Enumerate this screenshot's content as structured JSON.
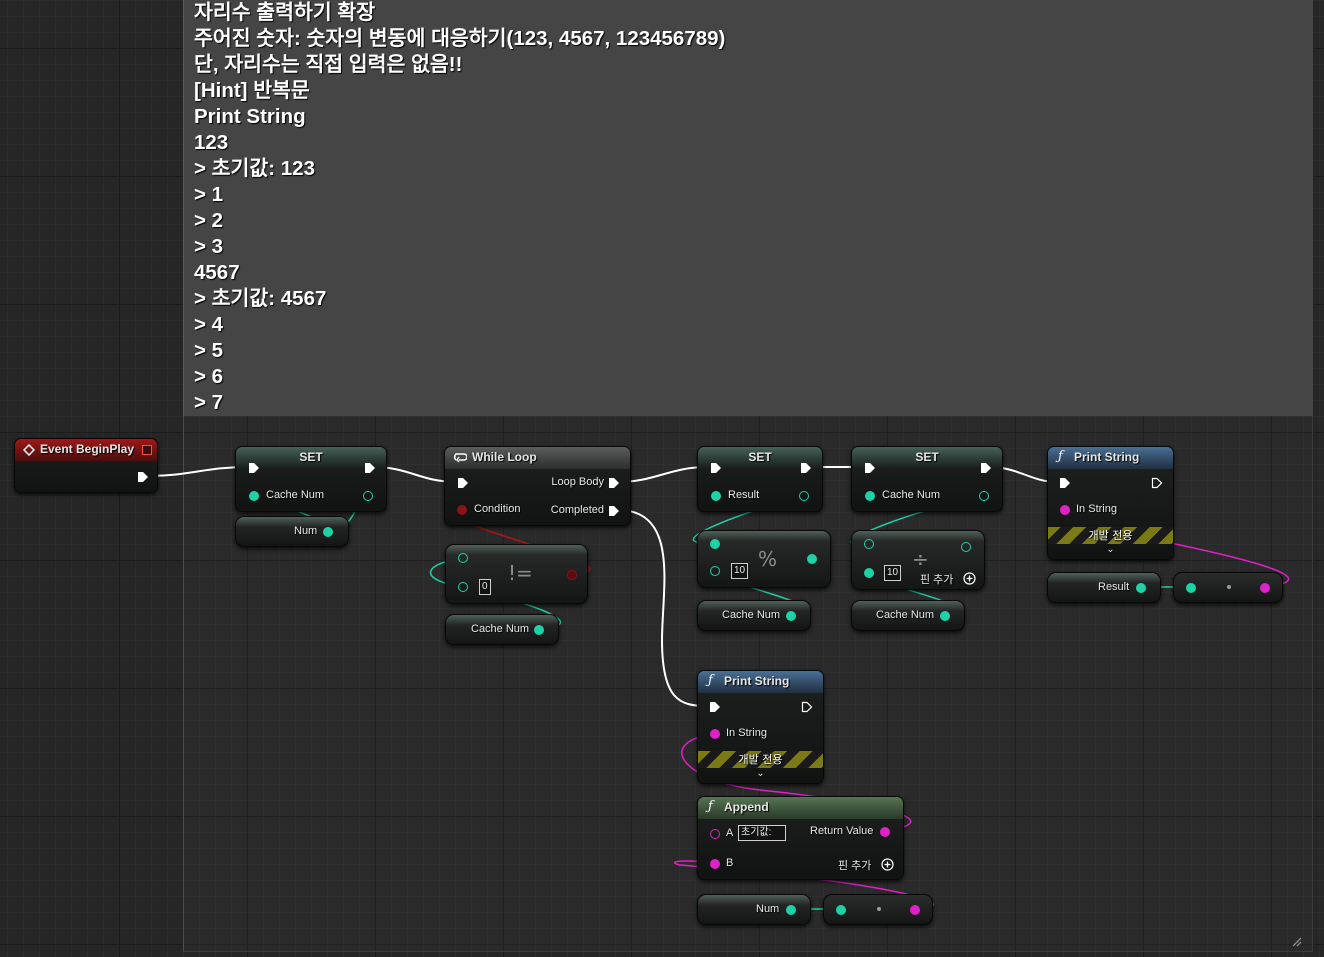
{
  "comment": {
    "lines": [
      "자리수 출력하기 확장",
      "주어진 숫자: 숫자의 변동에 대응하기(123, 4567, 123456789)",
      "단, 자리수는 직접 입력은 없음!!",
      "[Hint] 반복문",
      "Print String",
      "123",
      "> 초기값: 123",
      "> 1",
      "> 2",
      "> 3",
      "4567",
      "> 초기값: 4567",
      "> 4",
      "> 5",
      "> 6",
      "> 7"
    ]
  },
  "nodes": {
    "event": {
      "title": "Event BeginPlay"
    },
    "set1": {
      "title": "SET",
      "pin": "Cache Num"
    },
    "num1": {
      "label": "Num"
    },
    "while": {
      "title": "While Loop",
      "loop_body": "Loop Body",
      "condition": "Condition",
      "completed": "Completed"
    },
    "neq": {
      "op": "!=",
      "value": "0"
    },
    "cache1": {
      "label": "Cache Num"
    },
    "set2": {
      "title": "SET",
      "pin": "Result"
    },
    "mod": {
      "op": "%",
      "value": "10"
    },
    "cache2": {
      "label": "Cache Num"
    },
    "set3": {
      "title": "SET",
      "pin": "Cache Num"
    },
    "div": {
      "op": "÷",
      "value": "10",
      "add_pin": "핀 추가"
    },
    "cache3": {
      "label": "Cache Num"
    },
    "print1": {
      "title": "Print String",
      "in_string": "In String",
      "dev_only": "개발 전용"
    },
    "result": {
      "label": "Result"
    },
    "print2": {
      "title": "Print String",
      "in_string": "In String",
      "dev_only": "개발 전용"
    },
    "append": {
      "title": "Append",
      "a": "A",
      "a_value": "초기값:",
      "b": "B",
      "return_value": "Return Value",
      "add_pin": "핀 추가"
    },
    "num2": {
      "label": "Num"
    }
  },
  "colors": {
    "int": "#1ed2a8",
    "string": "#e020c8",
    "bool": "#8e1313",
    "exec": "#ffffff"
  },
  "icons": [
    "event-icon",
    "loop-icon",
    "function-icon",
    "add-pin-icon",
    "chevron-down-icon",
    "resize-grip-icon"
  ]
}
